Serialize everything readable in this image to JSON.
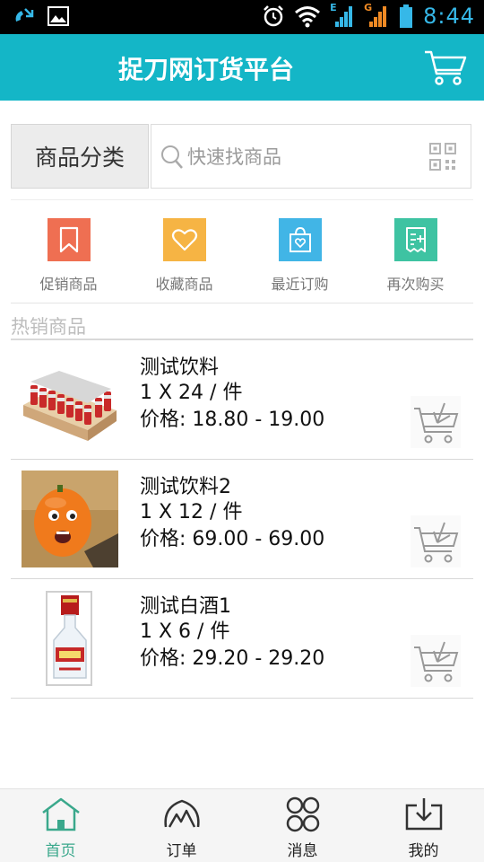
{
  "status_bar": {
    "time": "8:44",
    "network_1": "E",
    "network_2": "G"
  },
  "app_bar": {
    "title": "捉刀网订货平台",
    "cart_icon": "shopping-cart-icon"
  },
  "search": {
    "category_label": "商品分类",
    "placeholder": "快速找商品",
    "search_icon": "search-icon",
    "scan_icon": "qr-code-icon"
  },
  "quick_links": [
    {
      "label": "促销商品",
      "icon": "bookmark-icon",
      "color": "#ef6f52"
    },
    {
      "label": "收藏商品",
      "icon": "heart-icon",
      "color": "#f6b444"
    },
    {
      "label": "最近订购",
      "icon": "shopping-bag-icon",
      "color": "#41b5e6"
    },
    {
      "label": "再次购买",
      "icon": "receipt-icon",
      "color": "#3ec3a2"
    }
  ],
  "hot_section": {
    "title": "热销商品"
  },
  "products": [
    {
      "name": "测试饮料",
      "spec": "1 X 24 / 件",
      "price": "价格: 18.80 - 19.00"
    },
    {
      "name": "测试饮料2",
      "spec": "1 X 12 / 件",
      "price": "价格: 69.00 - 69.00"
    },
    {
      "name": "测试白酒1",
      "spec": "1 X 6 / 件",
      "price": "价格: 29.20 - 29.20"
    }
  ],
  "tabs": [
    {
      "label": "首页",
      "icon": "home-icon",
      "active": true
    },
    {
      "label": "订单",
      "icon": "orders-icon",
      "active": false
    },
    {
      "label": "消息",
      "icon": "messages-icon",
      "active": false
    },
    {
      "label": "我的",
      "icon": "download-tray-icon",
      "active": false
    }
  ],
  "colors": {
    "primary": "#14b6c7",
    "active_tab": "#3aa88c"
  }
}
